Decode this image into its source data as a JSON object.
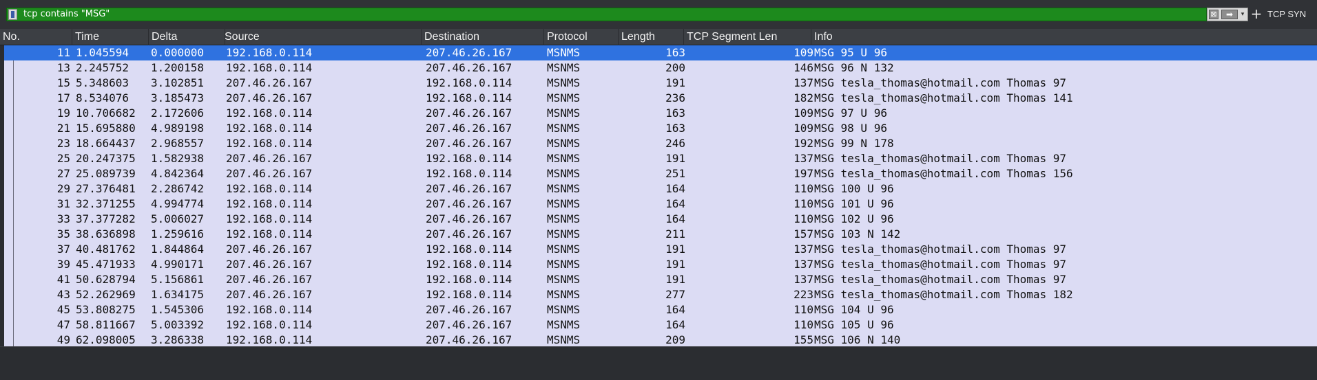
{
  "filter": {
    "value": "tcp contains \"MSG\"",
    "clear_label": "⊠",
    "apply_label": "➡",
    "dropdown_label": "▾",
    "add_label": "+",
    "button_tcp_syn": "TCP SYN"
  },
  "columns": [
    "No.",
    "Time",
    "Delta",
    "Source",
    "Destination",
    "Protocol",
    "Length",
    "TCP Segment Len",
    "Info"
  ],
  "selected_row": 0,
  "rows": [
    {
      "no": "11",
      "time": "1.045594",
      "delta": "0.000000",
      "source": "192.168.0.114",
      "destination": "207.46.26.167",
      "protocol": "MSNMS",
      "length": "163",
      "seglen": "109",
      "info": "MSG 95 U 96"
    },
    {
      "no": "13",
      "time": "2.245752",
      "delta": "1.200158",
      "source": "192.168.0.114",
      "destination": "207.46.26.167",
      "protocol": "MSNMS",
      "length": "200",
      "seglen": "146",
      "info": "MSG 96 N 132"
    },
    {
      "no": "15",
      "time": "5.348603",
      "delta": "3.102851",
      "source": "207.46.26.167",
      "destination": "192.168.0.114",
      "protocol": "MSNMS",
      "length": "191",
      "seglen": "137",
      "info": "MSG tesla_thomas@hotmail.com Thomas 97"
    },
    {
      "no": "17",
      "time": "8.534076",
      "delta": "3.185473",
      "source": "207.46.26.167",
      "destination": "192.168.0.114",
      "protocol": "MSNMS",
      "length": "236",
      "seglen": "182",
      "info": "MSG tesla_thomas@hotmail.com Thomas 141"
    },
    {
      "no": "19",
      "time": "10.706682",
      "delta": "2.172606",
      "source": "192.168.0.114",
      "destination": "207.46.26.167",
      "protocol": "MSNMS",
      "length": "163",
      "seglen": "109",
      "info": "MSG 97 U 96"
    },
    {
      "no": "21",
      "time": "15.695880",
      "delta": "4.989198",
      "source": "192.168.0.114",
      "destination": "207.46.26.167",
      "protocol": "MSNMS",
      "length": "163",
      "seglen": "109",
      "info": "MSG 98 U 96"
    },
    {
      "no": "23",
      "time": "18.664437",
      "delta": "2.968557",
      "source": "192.168.0.114",
      "destination": "207.46.26.167",
      "protocol": "MSNMS",
      "length": "246",
      "seglen": "192",
      "info": "MSG 99 N 178"
    },
    {
      "no": "25",
      "time": "20.247375",
      "delta": "1.582938",
      "source": "207.46.26.167",
      "destination": "192.168.0.114",
      "protocol": "MSNMS",
      "length": "191",
      "seglen": "137",
      "info": "MSG tesla_thomas@hotmail.com Thomas 97"
    },
    {
      "no": "27",
      "time": "25.089739",
      "delta": "4.842364",
      "source": "207.46.26.167",
      "destination": "192.168.0.114",
      "protocol": "MSNMS",
      "length": "251",
      "seglen": "197",
      "info": "MSG tesla_thomas@hotmail.com Thomas 156"
    },
    {
      "no": "29",
      "time": "27.376481",
      "delta": "2.286742",
      "source": "192.168.0.114",
      "destination": "207.46.26.167",
      "protocol": "MSNMS",
      "length": "164",
      "seglen": "110",
      "info": "MSG 100 U 96"
    },
    {
      "no": "31",
      "time": "32.371255",
      "delta": "4.994774",
      "source": "192.168.0.114",
      "destination": "207.46.26.167",
      "protocol": "MSNMS",
      "length": "164",
      "seglen": "110",
      "info": "MSG 101 U 96"
    },
    {
      "no": "33",
      "time": "37.377282",
      "delta": "5.006027",
      "source": "192.168.0.114",
      "destination": "207.46.26.167",
      "protocol": "MSNMS",
      "length": "164",
      "seglen": "110",
      "info": "MSG 102 U 96"
    },
    {
      "no": "35",
      "time": "38.636898",
      "delta": "1.259616",
      "source": "192.168.0.114",
      "destination": "207.46.26.167",
      "protocol": "MSNMS",
      "length": "211",
      "seglen": "157",
      "info": "MSG 103 N 142"
    },
    {
      "no": "37",
      "time": "40.481762",
      "delta": "1.844864",
      "source": "207.46.26.167",
      "destination": "192.168.0.114",
      "protocol": "MSNMS",
      "length": "191",
      "seglen": "137",
      "info": "MSG tesla_thomas@hotmail.com Thomas 97"
    },
    {
      "no": "39",
      "time": "45.471933",
      "delta": "4.990171",
      "source": "207.46.26.167",
      "destination": "192.168.0.114",
      "protocol": "MSNMS",
      "length": "191",
      "seglen": "137",
      "info": "MSG tesla_thomas@hotmail.com Thomas 97"
    },
    {
      "no": "41",
      "time": "50.628794",
      "delta": "5.156861",
      "source": "207.46.26.167",
      "destination": "192.168.0.114",
      "protocol": "MSNMS",
      "length": "191",
      "seglen": "137",
      "info": "MSG tesla_thomas@hotmail.com Thomas 97"
    },
    {
      "no": "43",
      "time": "52.262969",
      "delta": "1.634175",
      "source": "207.46.26.167",
      "destination": "192.168.0.114",
      "protocol": "MSNMS",
      "length": "277",
      "seglen": "223",
      "info": "MSG tesla_thomas@hotmail.com Thomas 182"
    },
    {
      "no": "45",
      "time": "53.808275",
      "delta": "1.545306",
      "source": "192.168.0.114",
      "destination": "207.46.26.167",
      "protocol": "MSNMS",
      "length": "164",
      "seglen": "110",
      "info": "MSG 104 U 96"
    },
    {
      "no": "47",
      "time": "58.811667",
      "delta": "5.003392",
      "source": "192.168.0.114",
      "destination": "207.46.26.167",
      "protocol": "MSNMS",
      "length": "164",
      "seglen": "110",
      "info": "MSG 105 U 96"
    },
    {
      "no": "49",
      "time": "62.098005",
      "delta": "3.286338",
      "source": "192.168.0.114",
      "destination": "207.46.26.167",
      "protocol": "MSNMS",
      "length": "209",
      "seglen": "155",
      "info": "MSG 106 N 140"
    }
  ],
  "colors": {
    "filter_valid_bg": "#1d8a1d",
    "row_bg": "#dcdcf4",
    "selected_bg": "#2f72e0"
  }
}
